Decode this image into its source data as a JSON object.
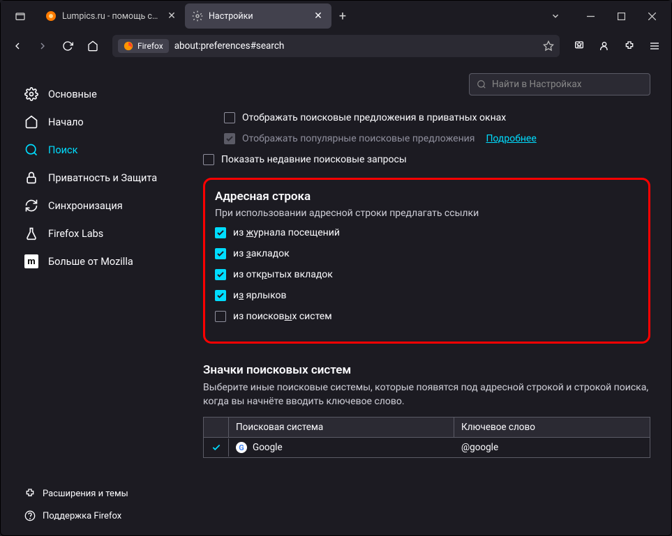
{
  "titlebar": {
    "tabs": [
      {
        "label": "Lumpics.ru - помощь с компь",
        "active": false
      },
      {
        "label": "Настройки",
        "active": true
      }
    ]
  },
  "navbar": {
    "identity_label": "Firefox",
    "url": "about:preferences#search"
  },
  "sidebar": {
    "categories": [
      {
        "key": "general",
        "label": "Основные"
      },
      {
        "key": "home",
        "label": "Начало"
      },
      {
        "key": "search",
        "label": "Поиск"
      },
      {
        "key": "privacy",
        "label": "Приватность и Защита"
      },
      {
        "key": "sync",
        "label": "Синхронизация"
      },
      {
        "key": "labs",
        "label": "Firefox Labs"
      },
      {
        "key": "more",
        "label": "Больше от Mozilla"
      }
    ],
    "footer": [
      {
        "key": "extensions",
        "label": "Расширения и темы"
      },
      {
        "key": "support",
        "label": "Поддержка Firefox"
      }
    ]
  },
  "content": {
    "search_placeholder": "Найти в Настройках",
    "suggestions": {
      "private": "Отображать поисковые предложения в приватных окнах",
      "trending": "Отображать популярные поисковые предложения",
      "trending_link": "Подробнее",
      "recent": "Показать недавние поисковые запросы"
    },
    "addressbar": {
      "title": "Адресная строка",
      "desc": "При использовании адресной строки предлагать ссылки",
      "items": [
        {
          "label_pre": "из ",
          "letter": "ж",
          "label_post": "урнала посещений",
          "checked": true
        },
        {
          "label_pre": "из ",
          "letter": "з",
          "label_post": "акладок",
          "checked": true
        },
        {
          "label_pre": "из отк",
          "letter": "р",
          "label_post": "ытых вкладок",
          "checked": true
        },
        {
          "label_pre": "и",
          "letter": "з",
          "label_post": " ярлыков",
          "checked": true
        },
        {
          "label_pre": "из поисков",
          "letter": "ы",
          "label_post": "х систем",
          "checked": false
        }
      ]
    },
    "engines": {
      "title": "Значки поисковых систем",
      "desc": "Выберите иные поисковые системы, которые появятся под адресной строкой и строкой поиска, когда вы начнёте вводить ключевое слово.",
      "col_name": "Поисковая система",
      "col_keyword": "Ключевое слово",
      "rows": [
        {
          "name": "Google",
          "keyword": "@google",
          "checked": true
        }
      ]
    }
  }
}
